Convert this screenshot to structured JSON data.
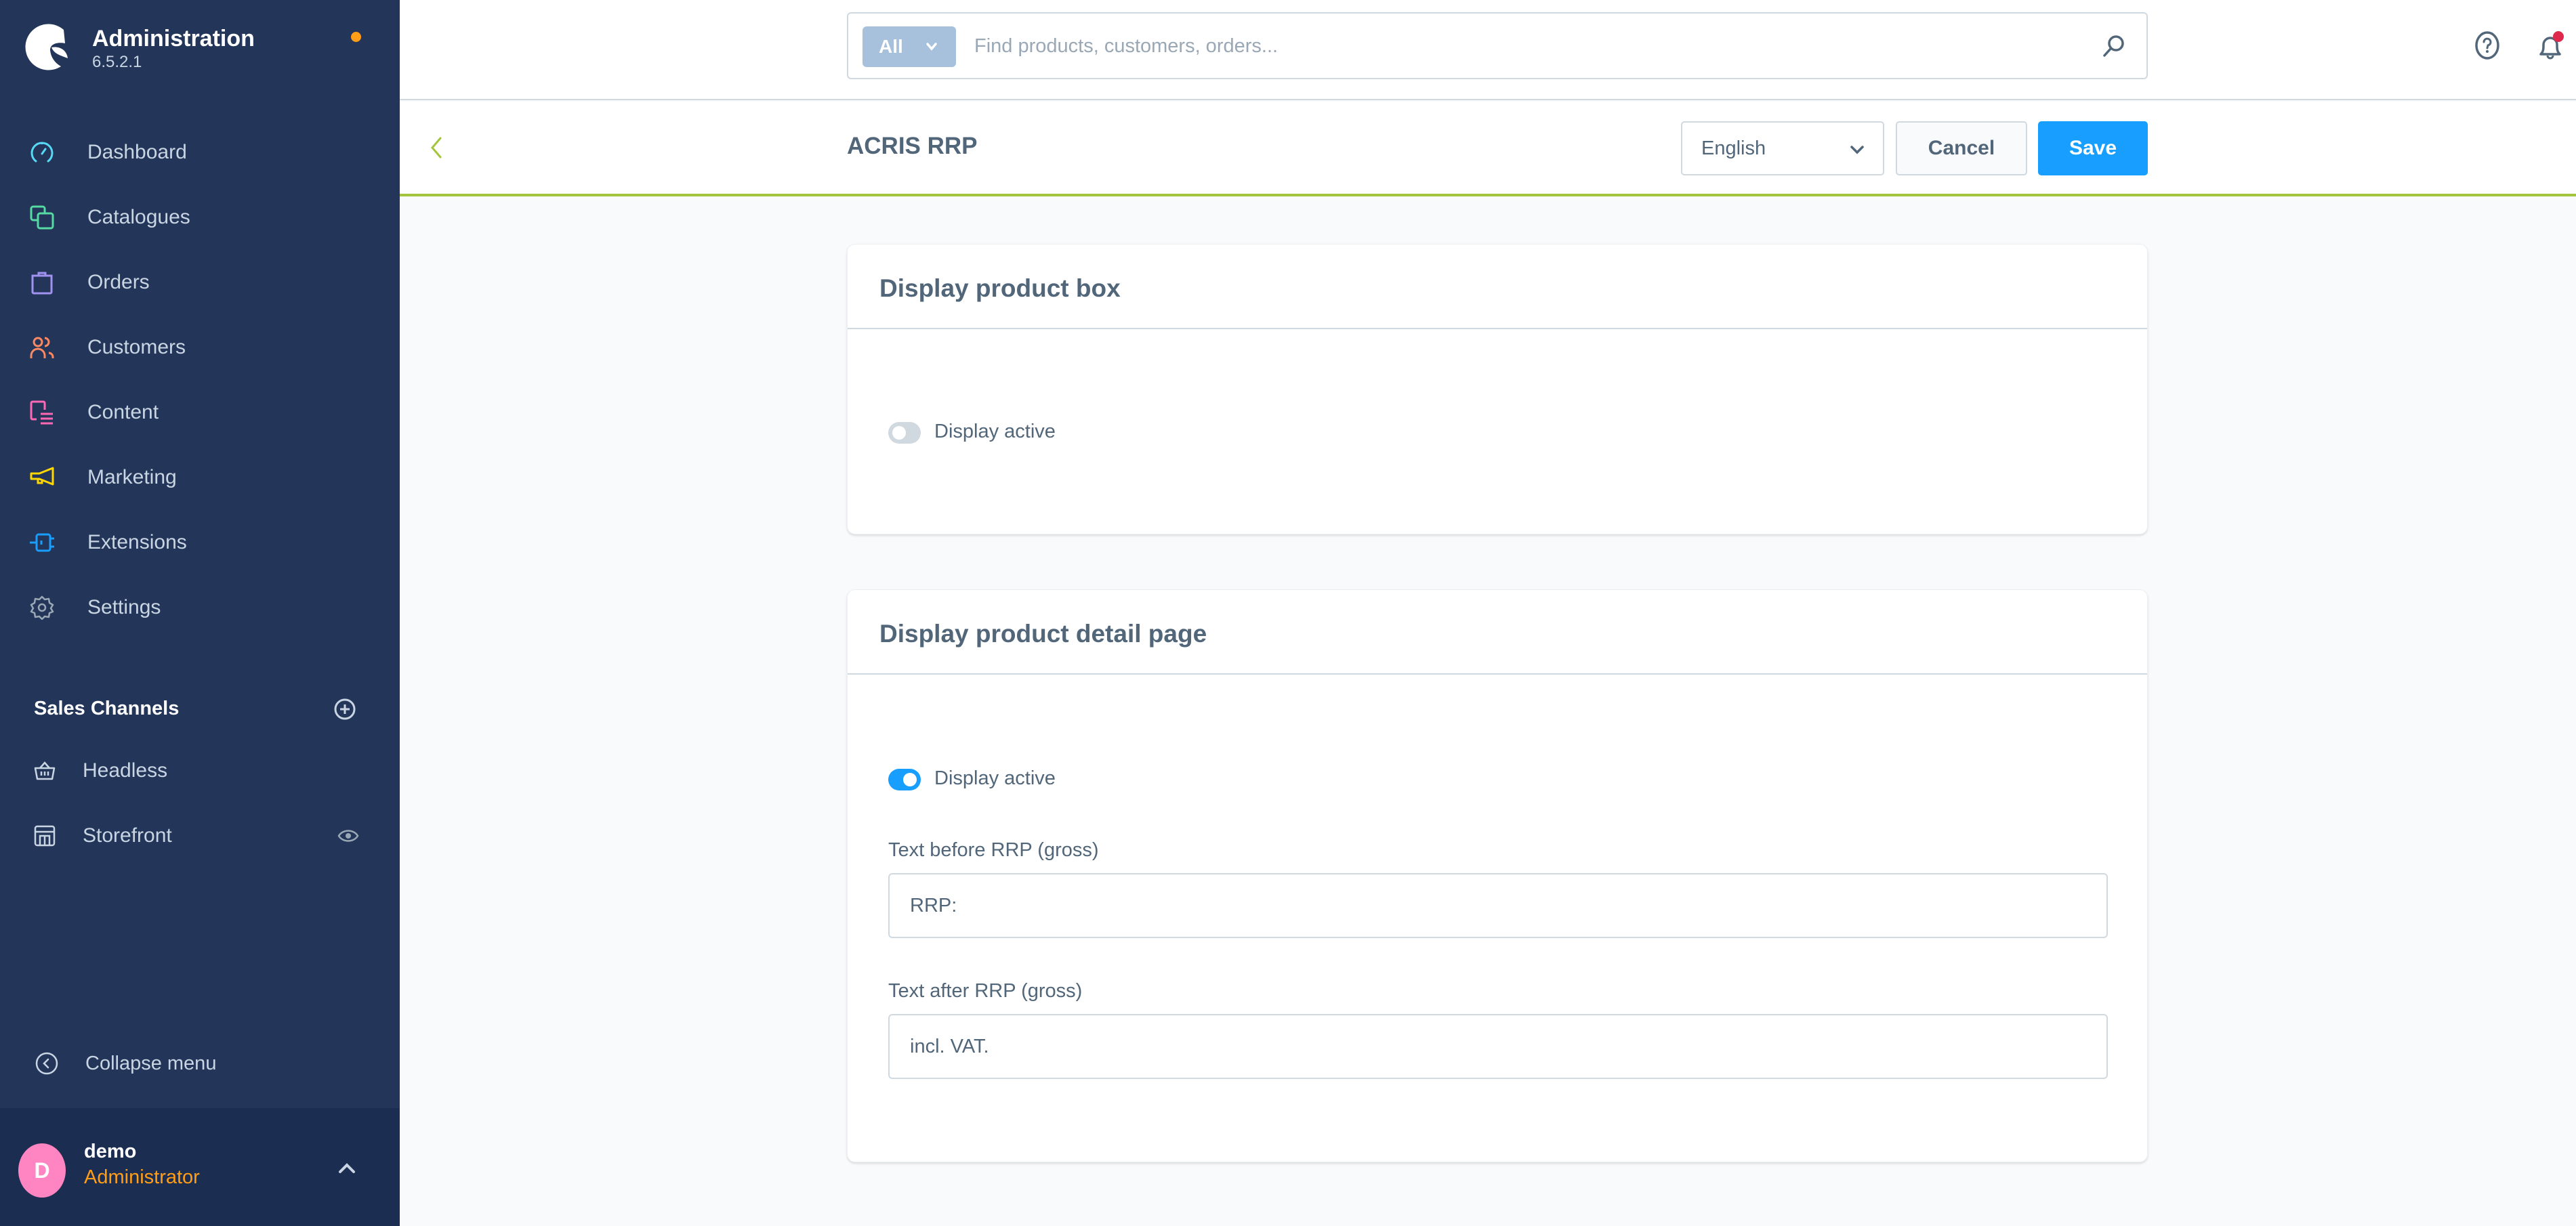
{
  "brand": {
    "title": "Administration",
    "version": "6.5.2.1",
    "status_dot_color": "#ff9e16"
  },
  "sidebar": {
    "items": [
      {
        "label": "Dashboard",
        "icon": "gauge-icon",
        "color": "#57d9f5"
      },
      {
        "label": "Catalogues",
        "icon": "copy-icon",
        "color": "#57d9a3"
      },
      {
        "label": "Orders",
        "icon": "shopping-bag-icon",
        "color": "#a092f0"
      },
      {
        "label": "Customers",
        "icon": "users-icon",
        "color": "#f88962"
      },
      {
        "label": "Content",
        "icon": "content-icon",
        "color": "#ff68b4"
      },
      {
        "label": "Marketing",
        "icon": "megaphone-icon",
        "color": "#ffd700"
      },
      {
        "label": "Extensions",
        "icon": "plug-icon",
        "color": "#189eff"
      },
      {
        "label": "Settings",
        "icon": "gear-icon",
        "color": "#9aa8b5"
      }
    ],
    "sales_channels": {
      "title": "Sales Channels",
      "items": [
        {
          "label": "Headless",
          "icon": "basket-icon"
        },
        {
          "label": "Storefront",
          "icon": "storefront-icon",
          "trailing_icon": "eye-icon"
        }
      ]
    },
    "collapse_label": "Collapse menu",
    "user": {
      "initial": "D",
      "name": "demo",
      "role": "Administrator"
    }
  },
  "topbar": {
    "search_type": "All",
    "search_placeholder": "Find products, customers, orders...",
    "search_value": "",
    "notification_dot_color": "#de294c"
  },
  "smartbar": {
    "title": "ACRIS RRP",
    "language": "English",
    "cancel_label": "Cancel",
    "save_label": "Save"
  },
  "cards": [
    {
      "title": "Display product box",
      "toggle_label": "Display active",
      "toggle_on": false
    },
    {
      "title": "Display product detail page",
      "toggle_label": "Display active",
      "toggle_on": true,
      "fields": [
        {
          "label": "Text before RRP (gross)",
          "value": "RRP:"
        },
        {
          "label": "Text after RRP (gross)",
          "value": "incl. VAT."
        }
      ]
    }
  ],
  "colors": {
    "sidebar_bg": "#233659",
    "primary": "#189eff",
    "accent_green": "#a3c43d",
    "text": "#52667a"
  }
}
